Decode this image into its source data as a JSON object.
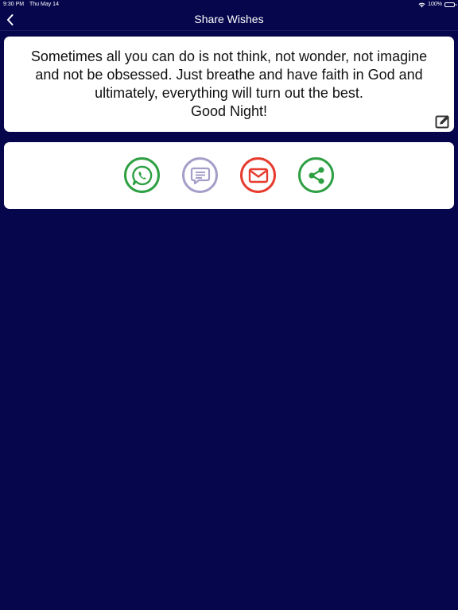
{
  "status_bar": {
    "time": "9:30 PM",
    "date": "Thu May 14",
    "battery": "100%"
  },
  "nav": {
    "title": "Share Wishes",
    "back_icon": "chevron-left-icon"
  },
  "message": {
    "text": "Sometimes all you can do is not think, not wonder, not imagine\nand not be obsessed. Just breathe and have faith in God and\nultimately, everything will turn out the best.\nGood Night!",
    "edit_icon": "edit-icon"
  },
  "share_options": [
    {
      "icon": "whatsapp-icon",
      "color": "#2ea043"
    },
    {
      "icon": "message-icon",
      "color": "#a59ec8"
    },
    {
      "icon": "mail-icon",
      "color": "#e63b2e"
    },
    {
      "icon": "share-icon",
      "color": "#2ea043"
    }
  ],
  "colors": {
    "background": "#06064d",
    "card": "#ffffff"
  }
}
